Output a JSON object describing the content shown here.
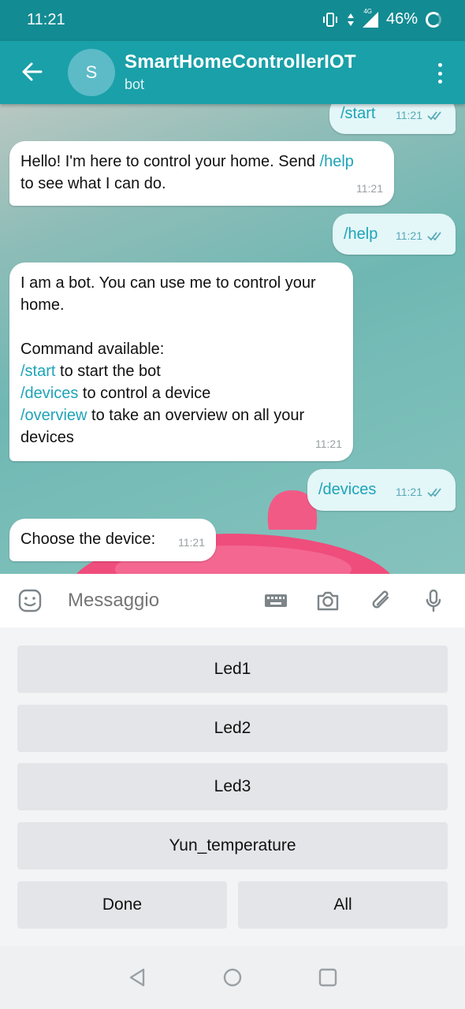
{
  "status_bar": {
    "time": "11:21",
    "network": "4G",
    "battery": "46%"
  },
  "header": {
    "avatar_letter": "S",
    "title": "SmartHomeControllerIOT",
    "subtitle": "bot"
  },
  "messages": [
    {
      "dir": "out",
      "text": "/start",
      "time": "11:21"
    },
    {
      "dir": "in",
      "parts": [
        "Hello! I'm here to control your home. Send ",
        "/help",
        "to see what I can do."
      ],
      "time": "11:21"
    },
    {
      "dir": "out",
      "text": "/help",
      "time": "11:21"
    },
    {
      "dir": "in",
      "intro": "I am a bot. You can use me to control your home.",
      "heading": "Command available:",
      "commands": [
        {
          "cmd": "/start",
          "desc": " to start the bot"
        },
        {
          "cmd": "/devices",
          "desc": " to control a device"
        },
        {
          "cmd": "/overview",
          "desc": " to take an overview on all your devices"
        }
      ],
      "time": "11:21"
    },
    {
      "dir": "out",
      "text": "/devices",
      "time": "11:21"
    },
    {
      "dir": "in",
      "text": "Choose the device:",
      "time": "11:21"
    }
  ],
  "input": {
    "placeholder": "Messaggio"
  },
  "keyboard": {
    "buttons": [
      "Led1",
      "Led2",
      "Led3",
      "Yun_temperature",
      "Done",
      "All"
    ]
  },
  "icons": {
    "back": "arrow-left-icon",
    "more": "more-vert-icon",
    "emoji": "sticker-emoji-icon",
    "bot_keyboard": "keyboard-icon",
    "camera": "camera-icon",
    "attach": "paperclip-icon",
    "mic": "microphone-icon",
    "nav_back": "triangle-back-icon",
    "nav_home": "circle-home-icon",
    "nav_recents": "square-recents-icon"
  },
  "colors": {
    "header": "#1aa0a8",
    "status_bar": "#138b93",
    "command_link": "#1ea4b8",
    "outgoing_bubble": "#e3f6f8"
  }
}
